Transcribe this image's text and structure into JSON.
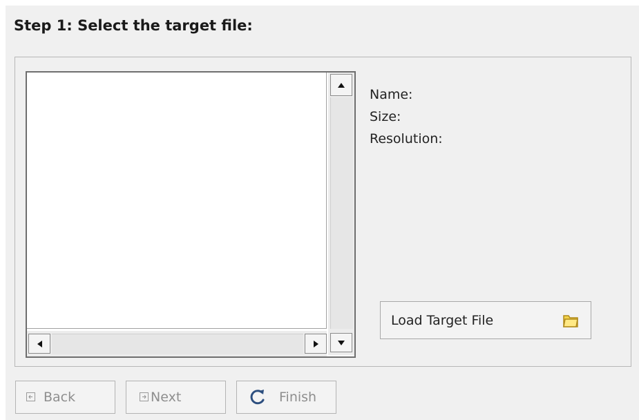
{
  "step": {
    "title": "Step 1: Select the target file:"
  },
  "file_info": {
    "name_label": "Name:",
    "size_label": "Size:",
    "resolution_label": "Resolution:"
  },
  "load": {
    "label": "Load Target File",
    "icon": "folder-icon"
  },
  "navigation": {
    "back_label": "Back",
    "next_label": "Next",
    "finish_label": "Finish"
  },
  "icons": {
    "back": "back-arrow-icon",
    "next": "next-arrow-icon",
    "finish": "refresh-icon",
    "scroll_up": "scroll-up-arrow-icon",
    "scroll_down": "scroll-down-arrow-icon",
    "scroll_left": "scroll-left-arrow-icon",
    "scroll_right": "scroll-right-arrow-icon"
  },
  "colors": {
    "dialog_background": "#f0f0f0",
    "disabled_text": "#8e8e8e",
    "text": "#222222",
    "folder_yellow": "#f3d34a",
    "refresh_blue": "#2d4f7f"
  }
}
